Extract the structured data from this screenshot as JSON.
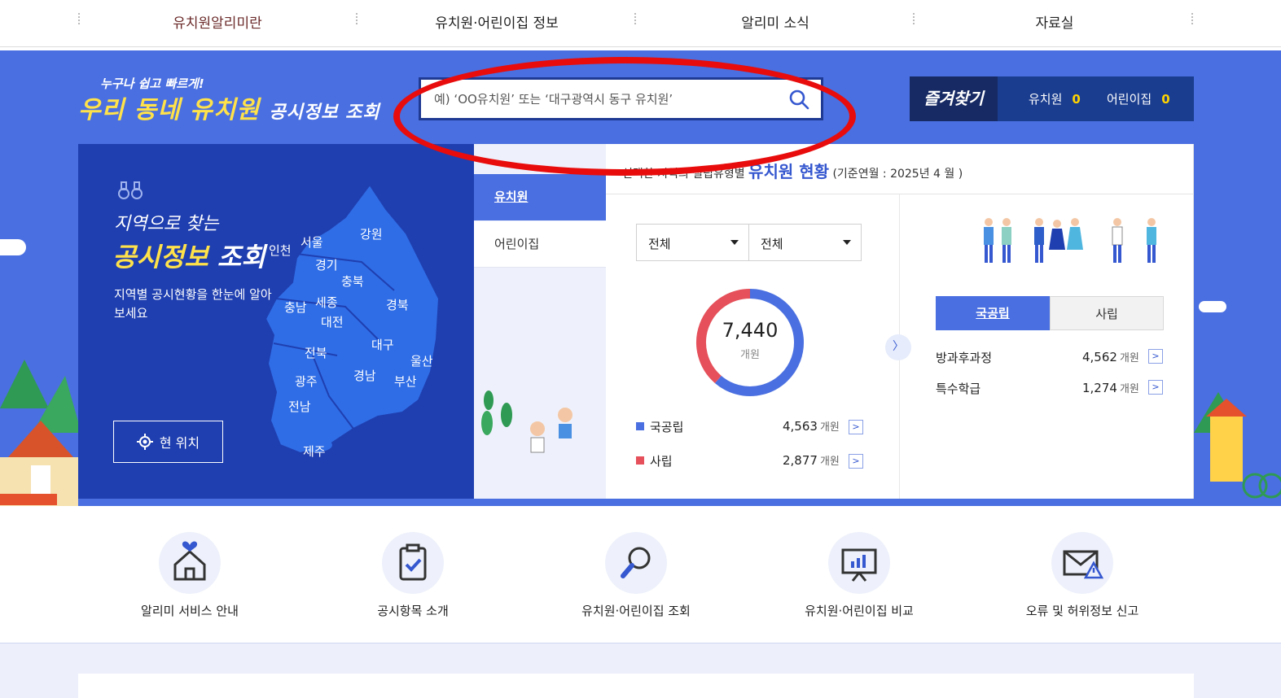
{
  "nav": {
    "items": [
      "유치원알리미란",
      "유치원·어린이집 정보",
      "알리미 소식",
      "자료실"
    ]
  },
  "hero": {
    "slogan_small": "누구나 쉽고 빠르게!",
    "slogan_big_a": "우리 동네 유치원",
    "slogan_big_b": "공시정보 조회",
    "search_placeholder": "예) ‘OO유치원’ 또는 ‘대구광역시 동구 유치원’",
    "favorites": {
      "title": "즐겨찾기",
      "kinder_label": "유치원",
      "kinder_count": "0",
      "daycare_label": "어린이집",
      "daycare_count": "0"
    }
  },
  "map_panel": {
    "title_line1": "지역으로 찾는",
    "title_line2a": "공시정보",
    "title_line2b": "조회",
    "desc": "지역별 공시현황을 한눈에 알아보세요",
    "location_button": "현 위치",
    "regions": [
      "서울",
      "강원",
      "인천",
      "경기",
      "충북",
      "충남",
      "세종",
      "경북",
      "대전",
      "대구",
      "전북",
      "울산",
      "광주",
      "경남",
      "부산",
      "전남",
      "제주"
    ]
  },
  "tabs": [
    "유치원",
    "어린이집"
  ],
  "stats": {
    "head_prefix": "선택한 지역의 설립유형별",
    "head_title": "유치원 현황",
    "head_suffix": "(기준연월 : 2025년 4 월 )",
    "select1": "전체",
    "select2": "전체",
    "total": "7,440",
    "total_unit": "개원",
    "legend": [
      {
        "label": "국공립",
        "value": "4,563",
        "unit": "개원",
        "color": "#4a6fe0"
      },
      {
        "label": "사립",
        "value": "2,877",
        "unit": "개원",
        "color": "#e5505a"
      }
    ],
    "segments": [
      "국공립",
      "사립"
    ],
    "programs": [
      {
        "label": "방과후과정",
        "value": "4,562",
        "unit": "개원"
      },
      {
        "label": "특수학급",
        "value": "1,274",
        "unit": "개원"
      }
    ],
    "more_symbol": ">",
    "next_symbol": "〉"
  },
  "quick_menu": [
    {
      "label": "알리미 서비스 안내",
      "icon": "home-heart-icon"
    },
    {
      "label": "공시항목 소개",
      "icon": "clipboard-check-icon"
    },
    {
      "label": "유치원·어린이집 조회",
      "icon": "magnifier-icon"
    },
    {
      "label": "유치원·어린이집 비교",
      "icon": "chart-board-icon"
    },
    {
      "label": "오류 및 허위정보 신고",
      "icon": "mail-warning-icon"
    }
  ]
}
